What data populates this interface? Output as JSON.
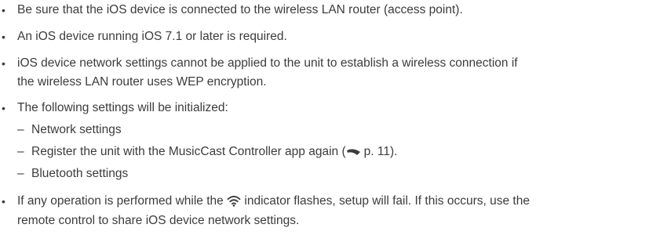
{
  "notes": [
    {
      "lines": [
        "Be sure that the iOS device is connected to the wireless LAN router (access point)."
      ]
    },
    {
      "lines": [
        "An iOS device running iOS 7.1 or later is required."
      ]
    },
    {
      "lines": [
        "iOS device network settings cannot be applied to the unit to establish a wireless connection if",
        "the wireless LAN router uses WEP encryption."
      ]
    },
    {
      "lines": [
        "The following settings will be initialized:"
      ],
      "subitems": [
        {
          "text": "Network settings"
        },
        {
          "text_before": "Register the unit with the MusicCast Controller app again (",
          "ref_page": "p. 11",
          "text_after": ")."
        },
        {
          "text": "Bluetooth settings"
        }
      ]
    },
    {
      "lines": [
        {
          "text_before": "If any operation is performed while the ",
          "icon": "wifi-icon",
          "text_after": " indicator flashes, setup will fail. If this occurs, use the"
        },
        "remote control to share iOS device network settings."
      ]
    }
  ],
  "bullet_symbol": "•",
  "dash_symbol": "–"
}
